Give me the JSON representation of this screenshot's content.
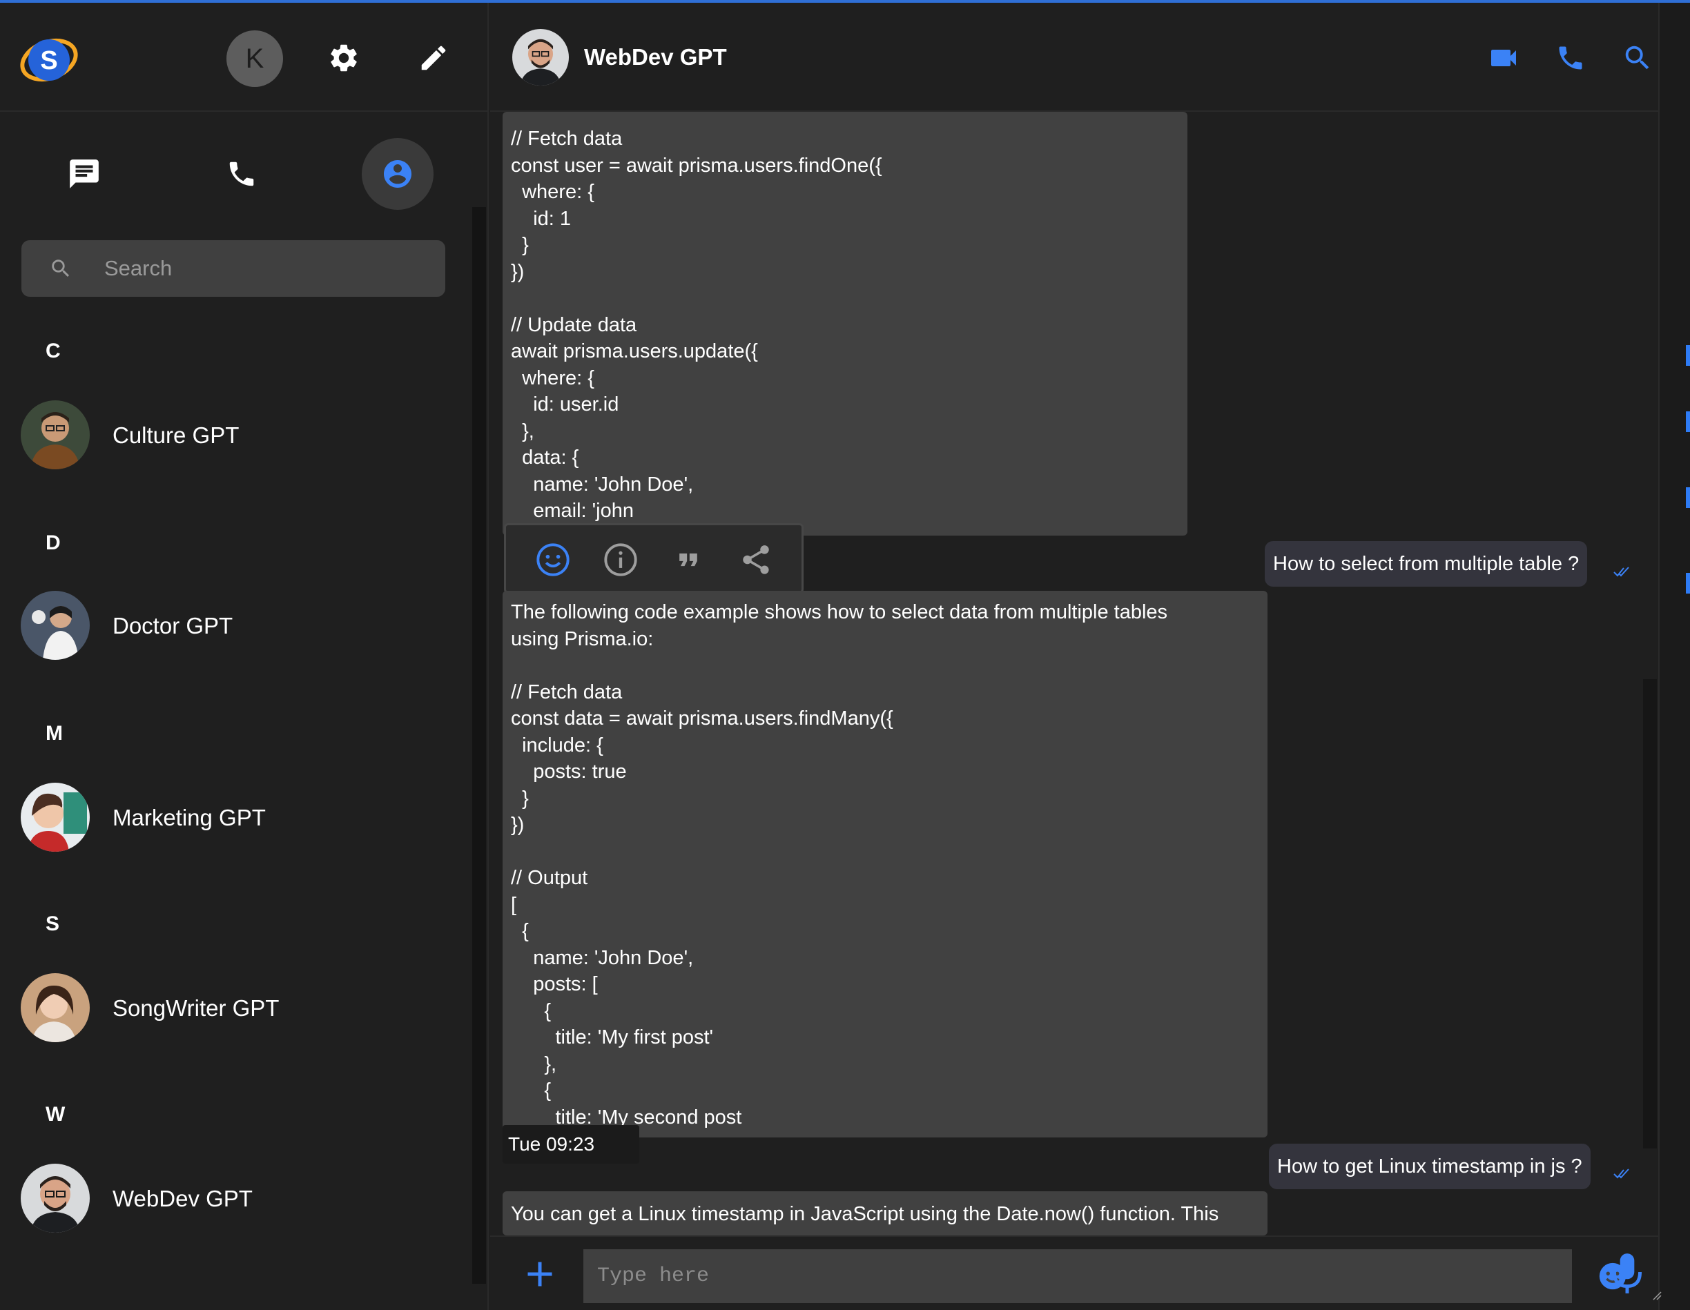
{
  "colors": {
    "accent": "#3b82f6",
    "bubble_in": "#414141",
    "bubble_out": "#34343d",
    "background": "#1f1f1f"
  },
  "sidebar": {
    "user_initial": "K",
    "search_placeholder": "Search",
    "groups": [
      {
        "letter": "C",
        "contacts": [
          {
            "name": "Culture GPT"
          }
        ]
      },
      {
        "letter": "D",
        "contacts": [
          {
            "name": "Doctor GPT"
          }
        ]
      },
      {
        "letter": "M",
        "contacts": [
          {
            "name": "Marketing GPT"
          }
        ]
      },
      {
        "letter": "S",
        "contacts": [
          {
            "name": "SongWriter GPT"
          }
        ]
      },
      {
        "letter": "W",
        "contacts": [
          {
            "name": "WebDev GPT"
          }
        ]
      }
    ],
    "icons": {
      "settings": "gear-icon",
      "compose": "pencil-icon",
      "chats": "chat-icon",
      "calls": "phone-icon",
      "contacts": "account-circle-icon"
    }
  },
  "chat": {
    "title": "WebDev GPT",
    "header_icons": [
      "video-icon",
      "phone-icon",
      "search-icon"
    ],
    "messages": [
      {
        "from": "bot",
        "text": "// Fetch data\nconst user = await prisma.users.findOne({\n  where: {\n    id: 1\n  }\n})\n\n// Update data\nawait prisma.users.update({\n  where: {\n    id: user.id\n  },\n  data: {\n    name: 'John Doe',\n    email: 'john"
      },
      {
        "from": "me",
        "text": "How to select from multiple table ?"
      },
      {
        "from": "bot",
        "text": "The following code example shows how to select data from multiple tables\nusing Prisma.io:\n\n// Fetch data\nconst data = await prisma.users.findMany({\n  include: {\n    posts: true\n  }\n})\n\n// Output\n[\n  {\n    name: 'John Doe',\n    posts: [\n      {\n        title: 'My first post'\n      },\n      {\n        title: 'My second post"
      },
      {
        "from": "me",
        "text": "How to get Linux timestamp in js ?"
      },
      {
        "from": "bot",
        "text": "You can get a Linux timestamp in JavaScript using the Date.now() function. This"
      }
    ],
    "timestamp": "Tue 09:23",
    "reaction_icons": [
      "emoji-icon",
      "info-icon",
      "quote-icon",
      "share-icon"
    ],
    "composer": {
      "placeholder": "Type here"
    }
  }
}
